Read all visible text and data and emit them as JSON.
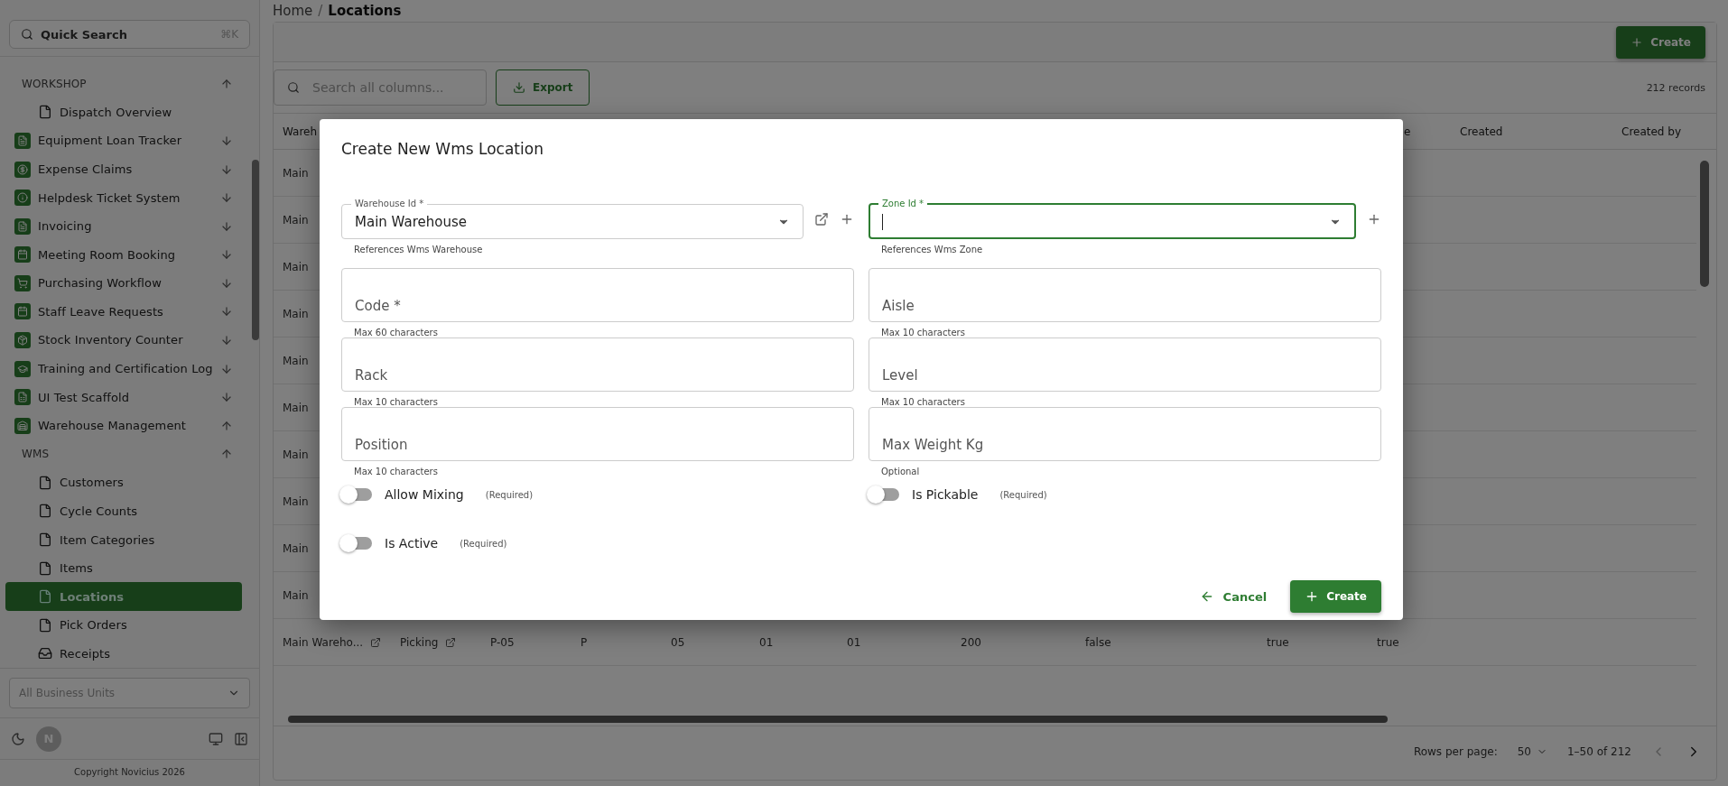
{
  "sidebar": {
    "search": {
      "placeholder": "Quick Search",
      "shortcut": "⌘K"
    },
    "nav": [
      {
        "label": "WORKSHOP",
        "kind": "section",
        "expanded": true,
        "children": [
          {
            "label": "Dispatch Overview",
            "kind": "page",
            "selected": false
          }
        ]
      },
      {
        "label": "Equipment Loan Tracker",
        "kind": "app",
        "expanded": false
      },
      {
        "label": "Expense Claims",
        "kind": "app",
        "expanded": false
      },
      {
        "label": "Helpdesk Ticket System",
        "kind": "app",
        "expanded": false
      },
      {
        "label": "Invoicing",
        "kind": "app",
        "expanded": false
      },
      {
        "label": "Meeting Room Booking",
        "kind": "app",
        "expanded": false
      },
      {
        "label": "Purchasing Workflow",
        "kind": "app",
        "expanded": false
      },
      {
        "label": "Staff Leave Requests",
        "kind": "app",
        "expanded": false
      },
      {
        "label": "Stock Inventory Counter",
        "kind": "app",
        "expanded": false
      },
      {
        "label": "Training and Certification Log",
        "kind": "app",
        "expanded": false
      },
      {
        "label": "UI Test Scaffold",
        "kind": "app",
        "expanded": false
      },
      {
        "label": "Warehouse Management",
        "kind": "app",
        "expanded": true,
        "children": [
          {
            "label": "WMS",
            "kind": "section",
            "expanded": true,
            "children": [
              {
                "label": "Customers",
                "kind": "page",
                "selected": false
              },
              {
                "label": "Cycle Counts",
                "kind": "page",
                "selected": false
              },
              {
                "label": "Item Categories",
                "kind": "page",
                "selected": false
              },
              {
                "label": "Items",
                "kind": "page",
                "selected": false
              },
              {
                "label": "Locations",
                "kind": "page",
                "selected": true
              },
              {
                "label": "Pick Orders",
                "kind": "page",
                "selected": false
              },
              {
                "label": "Receipts",
                "kind": "inbox",
                "selected": false
              }
            ]
          }
        ]
      }
    ],
    "business_unit": {
      "placeholder": "All Business Units"
    },
    "avatar": "N",
    "copyright": "Copyright Novicius 2026"
  },
  "breadcrumb": {
    "items": [
      "Home",
      "Locations"
    ],
    "separator": "/"
  },
  "create_button": "Create",
  "table_search": {
    "placeholder": "Search all columns..."
  },
  "export_button": "Export",
  "record_count": "212 records",
  "table": {
    "columns": [
      "Wareh",
      "e",
      "Created",
      "Created by"
    ],
    "rows": [
      {
        "cells": [
          {
            "text": "Main",
            "kind": "text"
          }
        ]
      },
      {
        "cells": [
          {
            "text": "Main",
            "kind": "text"
          }
        ]
      },
      {
        "cells": [
          {
            "text": "Main",
            "kind": "text"
          }
        ]
      },
      {
        "cells": [
          {
            "text": "Main",
            "kind": "text"
          }
        ]
      },
      {
        "cells": [
          {
            "text": "Main",
            "kind": "text"
          }
        ]
      },
      {
        "cells": [
          {
            "text": "Main",
            "kind": "text"
          }
        ]
      },
      {
        "cells": [
          {
            "text": "Main",
            "kind": "text"
          }
        ]
      },
      {
        "cells": [
          {
            "text": "Main",
            "kind": "text"
          }
        ]
      },
      {
        "cells": [
          {
            "text": "Main",
            "kind": "text"
          }
        ]
      },
      {
        "cells": [
          {
            "text": "Main",
            "kind": "text"
          }
        ]
      },
      {
        "cells": [
          {
            "text": "Main Wareho...",
            "kind": "link"
          },
          {
            "text": "Picking",
            "kind": "link"
          },
          {
            "text": "P-05",
            "kind": "text"
          },
          {
            "text": "P",
            "kind": "text"
          },
          {
            "text": "05",
            "kind": "text"
          },
          {
            "text": "01",
            "kind": "text"
          },
          {
            "text": "01",
            "kind": "text"
          },
          {
            "text": "200",
            "kind": "text"
          },
          {
            "text": "false",
            "kind": "text"
          },
          {
            "text": "true",
            "kind": "text"
          },
          {
            "text": "true",
            "kind": "text"
          }
        ]
      }
    ]
  },
  "pagination": {
    "rows_per_page_label": "Rows per page:",
    "rows_per_page": "50",
    "range": "1–50 of 212"
  },
  "dialog": {
    "title": "Create New Wms Location",
    "fields": [
      {
        "kind": "select",
        "label": "Warehouse Id *",
        "value": "Main Warehouse",
        "helper": "References Wms Warehouse",
        "focused": false,
        "actions": [
          {
            "kind": "open"
          },
          {
            "kind": "add"
          }
        ]
      },
      {
        "kind": "select",
        "label": "Zone Id *",
        "helper": "References Wms Zone",
        "focused": true,
        "actions": [
          {
            "kind": "add"
          }
        ]
      },
      {
        "kind": "text",
        "label": "Code *",
        "helper": "Max 60 characters",
        "focused": false
      },
      {
        "kind": "text",
        "label": "Aisle",
        "helper": "Max 10 characters",
        "focused": false
      },
      {
        "kind": "text",
        "label": "Rack",
        "helper": "Max 10 characters",
        "focused": false
      },
      {
        "kind": "text",
        "label": "Level",
        "helper": "Max 10 characters",
        "focused": false
      },
      {
        "kind": "text",
        "label": "Position",
        "helper": "Max 10 characters",
        "focused": false
      },
      {
        "kind": "text",
        "label": "Max Weight Kg",
        "helper": "Optional",
        "focused": false
      },
      {
        "kind": "toggle",
        "label": "Allow Mixing",
        "note": "(Required)",
        "on": false
      },
      {
        "kind": "toggle",
        "label": "Is Pickable",
        "note": "(Required)",
        "on": false
      },
      {
        "kind": "toggle",
        "label": "Is Active",
        "note": "(Required)",
        "on": false
      }
    ],
    "cancel": "Cancel",
    "submit": "Create"
  }
}
